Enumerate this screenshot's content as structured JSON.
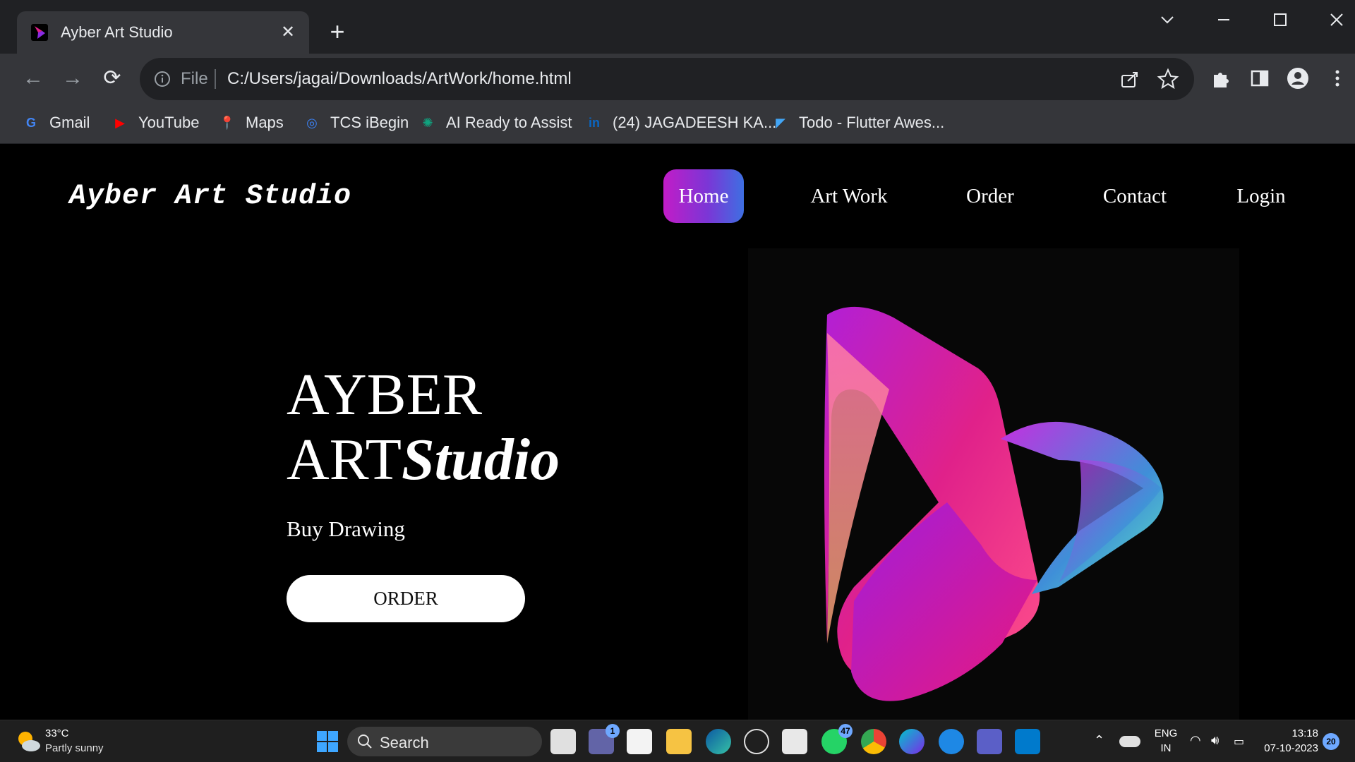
{
  "browser": {
    "tab": {
      "title": "Ayber Art Studio",
      "close_glyph": "✕",
      "favicon": "ayber-favicon"
    },
    "new_tab_glyph": "+",
    "window_controls": {
      "list_tabs": "⌵",
      "minimize": "—",
      "maximize": "☐",
      "close": "✕"
    },
    "toolbar": {
      "back_glyph": "←",
      "forward_glyph": "→",
      "reload_glyph": "⟳",
      "scheme_label": "File",
      "url": "C:/Users/jagai/Downloads/ArtWork/home.html"
    },
    "bookmarks": [
      {
        "label": "Gmail",
        "icon": "google-icon",
        "glyph": "G",
        "color": "#4285f4"
      },
      {
        "label": "YouTube",
        "icon": "youtube-icon",
        "glyph": "▶",
        "color": "#ff0000"
      },
      {
        "label": "Maps",
        "icon": "maps-icon",
        "glyph": "📍",
        "color": "#34a853"
      },
      {
        "label": "TCS iBegin",
        "icon": "tcs-icon",
        "glyph": "◎",
        "color": "#3b82f6"
      },
      {
        "label": "AI Ready to Assist",
        "icon": "openai-icon",
        "glyph": "✺",
        "color": "#10a37f"
      },
      {
        "label": "(24) JAGADEESH KA...",
        "icon": "linkedin-icon",
        "glyph": "in",
        "color": "#0a66c2"
      },
      {
        "label": "Todo - Flutter Awes...",
        "icon": "flutter-icon",
        "glyph": "◤",
        "color": "#42a5f5"
      }
    ]
  },
  "site": {
    "logo": "Ayber Art Studio",
    "nav": [
      "Home",
      "Art Work",
      "Order",
      "Contact",
      "Login"
    ],
    "active_nav": "Home",
    "hero": {
      "title_line1": "AYBER",
      "title_line2_plain": "ART",
      "title_line2_italic": "Studio",
      "subtitle": "Buy Drawing",
      "cta": "ORDER"
    },
    "colors": {
      "nav_active_start": "#c21cc7",
      "nav_active_end": "#3e6fe2",
      "background": "#000000"
    }
  },
  "taskbar": {
    "weather": {
      "temp": "33°C",
      "desc": "Partly sunny"
    },
    "search_placeholder": "Search",
    "badges": {
      "chat": "1",
      "whatsapp": "47",
      "notifications": "20"
    },
    "apps": [
      "start-icon",
      "task-view-icon",
      "teams-chat-icon",
      "store-icon",
      "file-explorer-icon",
      "edge-icon",
      "dell-icon",
      "notepad-icon",
      "whatsapp-icon",
      "chrome-icon",
      "canva-icon",
      "app-store-icon",
      "teams-icon",
      "vscode-icon"
    ],
    "tray": {
      "lang": "ENG",
      "region": "IN",
      "time": "13:18",
      "date": "07-10-2023"
    }
  }
}
